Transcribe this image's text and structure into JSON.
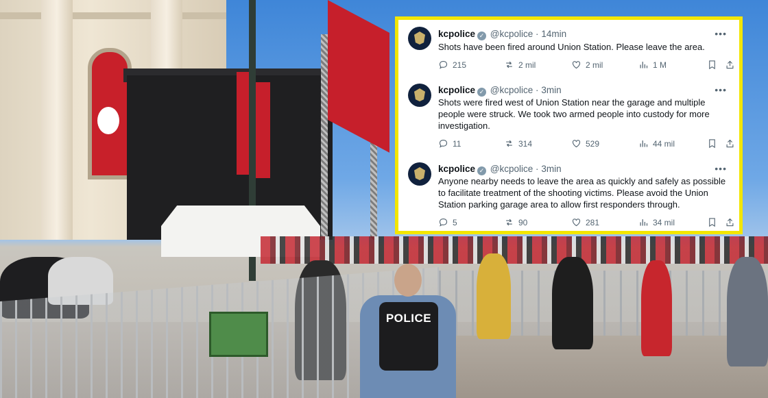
{
  "scene": {
    "officer_vest_text": "POLICE"
  },
  "tweets": [
    {
      "name": "kcpolice",
      "handle": "@kcpolice",
      "dot": "·",
      "time": "14min",
      "text": "Shots have been fired around Union Station. Please leave the area.",
      "replies": "215",
      "reposts": "2 mil",
      "likes": "2 mil",
      "views": "1 M"
    },
    {
      "name": "kcpolice",
      "handle": "@kcpolice",
      "dot": "·",
      "time": "3min",
      "text": "Shots were fired west of Union Station near the garage and multiple people were struck. We took two armed people into custody for more investigation.",
      "replies": "11",
      "reposts": "314",
      "likes": "529",
      "views": "44 mil"
    },
    {
      "name": "kcpolice",
      "handle": "@kcpolice",
      "dot": "·",
      "time": "3min",
      "text": "Anyone nearby needs to leave the area as quickly and safely as possible to facilitate treatment of the shooting victims. Please avoid the Union Station parking garage area to allow first responders through.",
      "replies": "5",
      "reposts": "90",
      "likes": "281",
      "views": "34 mil"
    }
  ],
  "icons": {
    "verified": "verified-badge-icon",
    "more": "more-options-icon",
    "reply": "reply-icon",
    "repost": "repost-icon",
    "like": "heart-icon",
    "views": "views-chart-icon",
    "bookmark": "bookmark-icon",
    "share": "share-icon"
  },
  "colors": {
    "highlight_border": "#f3e600",
    "secondary_text": "#536471",
    "primary_text": "#0f1419"
  }
}
